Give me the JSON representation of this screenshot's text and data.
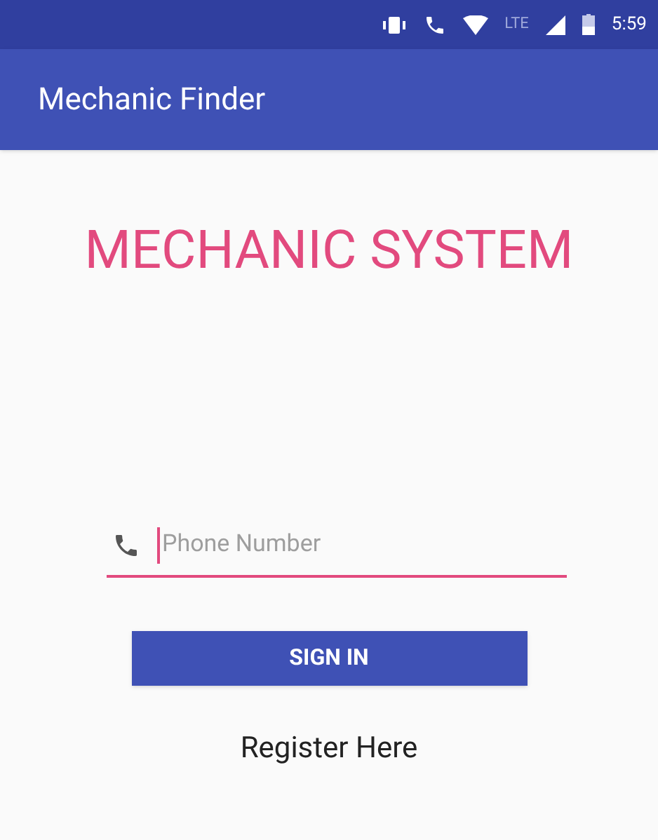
{
  "status_bar": {
    "network": "LTE",
    "time": "5:59"
  },
  "app_bar": {
    "title": "Mechanic Finder"
  },
  "heading": "MECHANIC SYSTEM",
  "phone_field": {
    "placeholder": "Phone Number",
    "focused": true
  },
  "sign_in_button": "SIGN IN",
  "register_link": "Register Here"
}
